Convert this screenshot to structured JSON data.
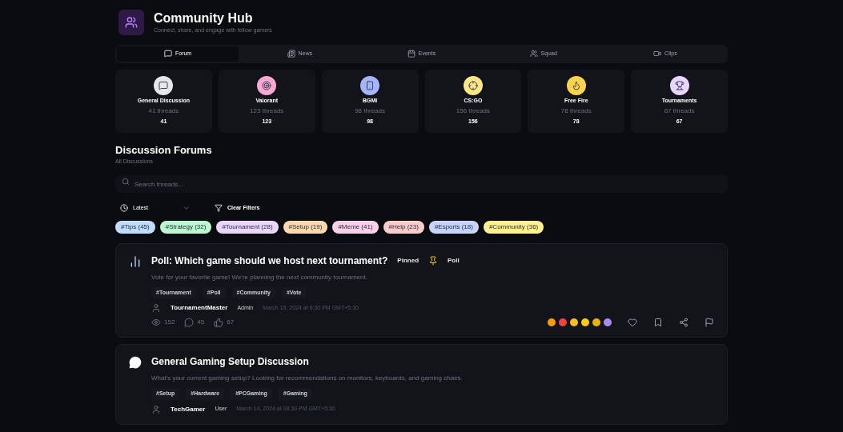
{
  "header": {
    "title": "Community Hub",
    "subtitle": "Connect, share, and engage with fellow gamers"
  },
  "tabs": [
    {
      "label": "Forum",
      "selected": true
    },
    {
      "label": "News",
      "selected": false
    },
    {
      "label": "Events",
      "selected": false
    },
    {
      "label": "Squad",
      "selected": false
    },
    {
      "label": "Clips",
      "selected": false
    }
  ],
  "categories": [
    {
      "name": "General Discussion",
      "threads": "41 threads",
      "count": "41",
      "color": "#e5e7eb"
    },
    {
      "name": "Valorant",
      "threads": "123 threads",
      "count": "123",
      "color": "#f9a8d4"
    },
    {
      "name": "BGMI",
      "threads": "98 threads",
      "count": "98",
      "color": "#a5b4fc"
    },
    {
      "name": "CS:GO",
      "threads": "156 threads",
      "count": "156",
      "color": "#fde68a"
    },
    {
      "name": "Free Fire",
      "threads": "78 threads",
      "count": "78",
      "color": "#fcd34d"
    },
    {
      "name": "Tournaments",
      "threads": "67 threads",
      "count": "67",
      "color": "#e9d5ff"
    }
  ],
  "section": {
    "title": "Discussion Forums",
    "subtitle": "All Discussions"
  },
  "search": {
    "placeholder": "Search threads..."
  },
  "sort": {
    "value": "Latest"
  },
  "clear_filters": "Clear Filters",
  "tags": [
    {
      "label": "#Tips (45)",
      "color": "#bfdbfe"
    },
    {
      "label": "#Strategy (32)",
      "color": "#bbf7d0"
    },
    {
      "label": "#Tournament (28)",
      "color": "#e9d5ff"
    },
    {
      "label": "#Setup (19)",
      "color": "#fed7aa"
    },
    {
      "label": "#Meme (41)",
      "color": "#fbcfe8"
    },
    {
      "label": "#Help (23)",
      "color": "#fecaca"
    },
    {
      "label": "#Esports (18)",
      "color": "#c7d2fe"
    },
    {
      "label": "#Community (36)",
      "color": "#fef08a"
    }
  ],
  "threads": [
    {
      "title": "Poll: Which game should we host next tournament?",
      "pinned": true,
      "badge": "Pinned",
      "type": "Poll",
      "description": "Vote for your favorite game! We're planning the next community tournament.",
      "tags": [
        "#Tournament",
        "#Poll",
        "#Community",
        "#Vote"
      ],
      "author": "TournamentMaster",
      "role": "Admin",
      "date": "March 15, 2024 at 6:30 PM GMT+5:30",
      "views": "152",
      "comments": "45",
      "likes": "67",
      "reactions": [
        {
          "color": "#f59e0b"
        },
        {
          "color": "#ef4444"
        },
        {
          "color": "#fbbf24"
        },
        {
          "color": "#facc15"
        },
        {
          "color": "#eab308"
        },
        {
          "color": "#a78bfa"
        }
      ]
    },
    {
      "title": "General Gaming Setup Discussion",
      "pinned": false,
      "description": "What's your current gaming setup? Looking for recommendations on monitors, keyboards, and gaming chairs.",
      "tags": [
        "#Setup",
        "#Hardware",
        "#PCGaming",
        "#Gaming"
      ],
      "author": "TechGamer",
      "role": "User",
      "date": "March 14, 2024 at 08:30 PM GMT+5:30"
    }
  ]
}
